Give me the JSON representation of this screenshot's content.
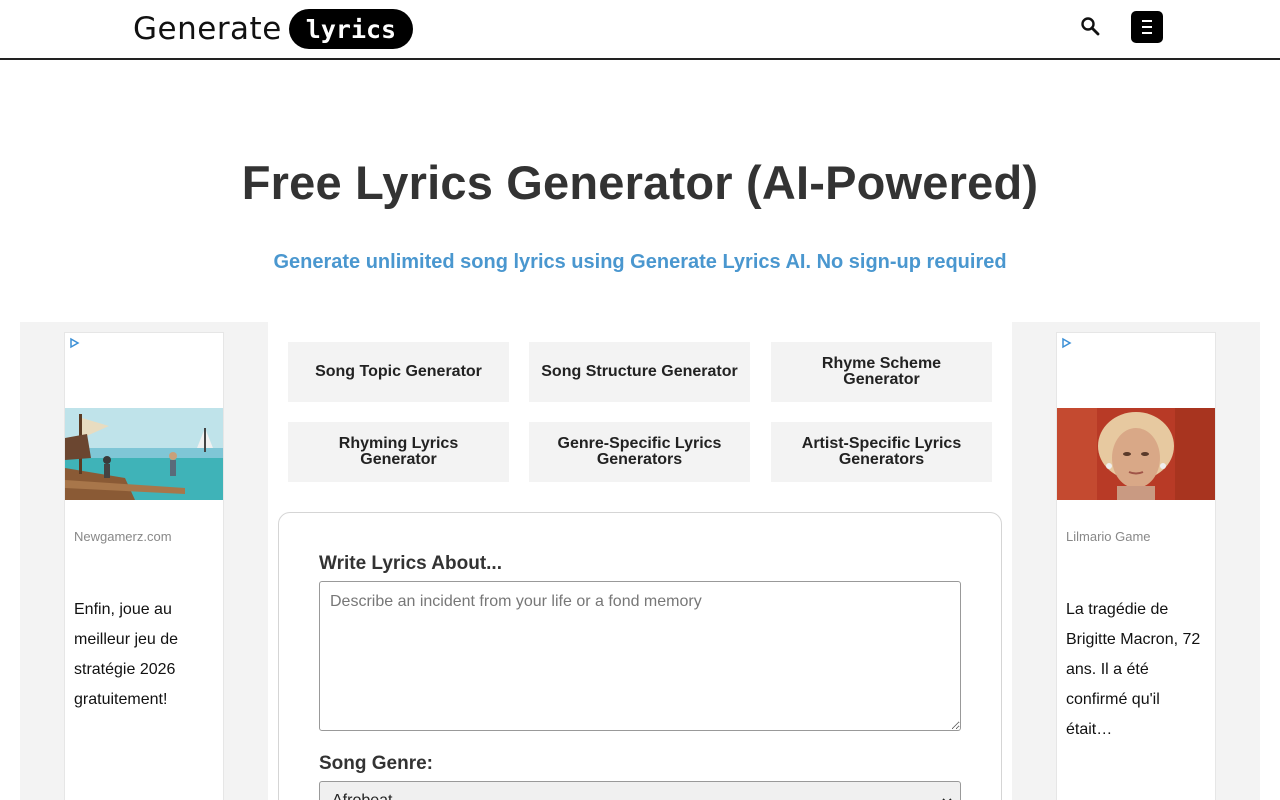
{
  "header": {
    "logo_word": "Generate",
    "logo_pill": "lyrics",
    "search_icon": "search-icon",
    "menu_icon": "hamburger-menu-icon"
  },
  "hero": {
    "title": "Free Lyrics Generator (AI-Powered)",
    "subtitle": "Generate unlimited song lyrics using Generate Lyrics AI. No sign-up required"
  },
  "tools": [
    {
      "label": "Song Topic Generator"
    },
    {
      "label": "Song Structure Generator"
    },
    {
      "label": "Rhyme Scheme Generator"
    },
    {
      "label": "Rhyming Lyrics Generator"
    },
    {
      "label": "Genre-Specific Lyrics Generators"
    },
    {
      "label": "Artist-Specific Lyrics Generators"
    }
  ],
  "form": {
    "topic_label": "Write Lyrics About...",
    "topic_placeholder": "Describe an incident from your life or a fond memory",
    "topic_value": "",
    "genre_label": "Song Genre:",
    "genre_value": "Afrobeat"
  },
  "ads": {
    "left": {
      "source": "Newgamerz.com",
      "text": "Enfin, joue au meilleur jeu de stratégie 2026 gratuitement!"
    },
    "right": {
      "source": "Lilmario Game",
      "text": "La tragédie de Brigitte Macron, 72 ans. Il a été confirmé qu'il était…"
    }
  },
  "colors": {
    "accent_blue": "#4a97cf",
    "tool_bg": "#f3f3f3",
    "text_dark": "#333333"
  }
}
